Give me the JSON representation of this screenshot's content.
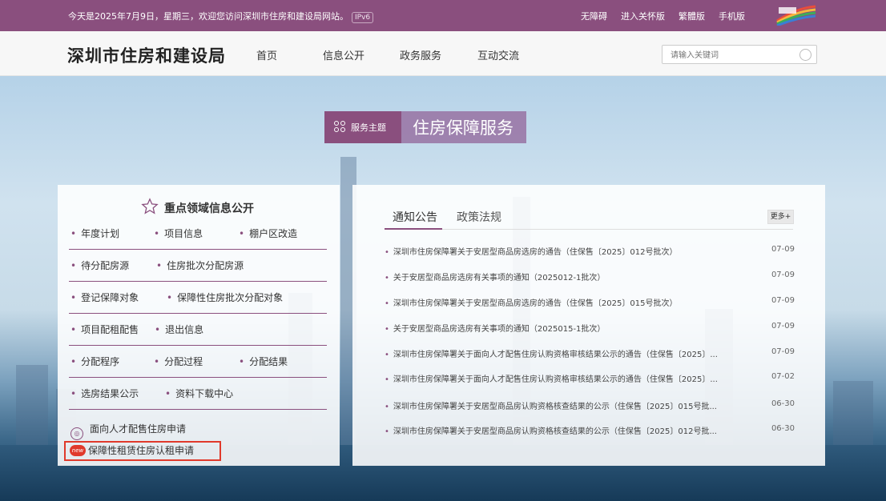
{
  "topbar": {
    "welcome": "今天是2025年7月9日，星期三，欢迎您访问深圳市住房和建设局网站。",
    "ipv6": "IPv6",
    "links": [
      "无障碍",
      "进入关怀版",
      "繁體版",
      "手机版"
    ]
  },
  "header": {
    "site_title": "深圳市住房和建设局",
    "nav": [
      "首页",
      "信息公开",
      "政务服务",
      "互动交流"
    ],
    "search_placeholder": "请输入关键词"
  },
  "theme": {
    "tag": "服务主题",
    "name": "住房保障服务"
  },
  "left_panel": {
    "title": "重点领域信息公开",
    "rows": [
      [
        "年度计划",
        "项目信息",
        "棚户区改造"
      ],
      [
        "待分配房源",
        "住房批次分配房源"
      ],
      [
        "登记保障对象",
        "保障性住房批次分配对象"
      ],
      [
        "项目配租配售",
        "退出信息"
      ],
      [
        "分配程序",
        "分配过程",
        "分配结果"
      ],
      [
        "选房结果公示",
        "资料下载中心"
      ]
    ],
    "app1": "面向人才配售住房申请",
    "app2": "保障性租赁住房认租申请",
    "new_badge": "new"
  },
  "right_panel": {
    "tabs": [
      "通知公告",
      "政策法规"
    ],
    "more": "更多+",
    "notices": [
      {
        "title": "深圳市住房保障署关于安居型商品房选房的通告（住保售〔2025〕012号批次）",
        "date": "07-09"
      },
      {
        "title": "关于安居型商品房选房有关事项的通知（2025012-1批次）",
        "date": "07-09"
      },
      {
        "title": "深圳市住房保障署关于安居型商品房选房的通告（住保售〔2025〕015号批次）",
        "date": "07-09"
      },
      {
        "title": "关于安居型商品房选房有关事项的通知（2025015-1批次）",
        "date": "07-09"
      },
      {
        "title": "深圳市住房保障署关于面向人才配售住房认购资格审核结果公示的通告（住保售〔2025〕...",
        "date": "07-09"
      },
      {
        "title": "深圳市住房保障署关于面向人才配售住房认购资格审核结果公示的通告（住保售〔2025〕...",
        "date": "07-02"
      },
      {
        "title": "深圳市住房保障署关于安居型商品房认购资格核查结果的公示（住保售〔2025〕015号批...",
        "date": "06-30"
      },
      {
        "title": "深圳市住房保障署关于安居型商品房认购资格核查结果的公示（住保售〔2025〕012号批...",
        "date": "06-30"
      }
    ]
  },
  "colors": {
    "brand": "#8a4f7e",
    "new_badge": "#e0392b"
  }
}
